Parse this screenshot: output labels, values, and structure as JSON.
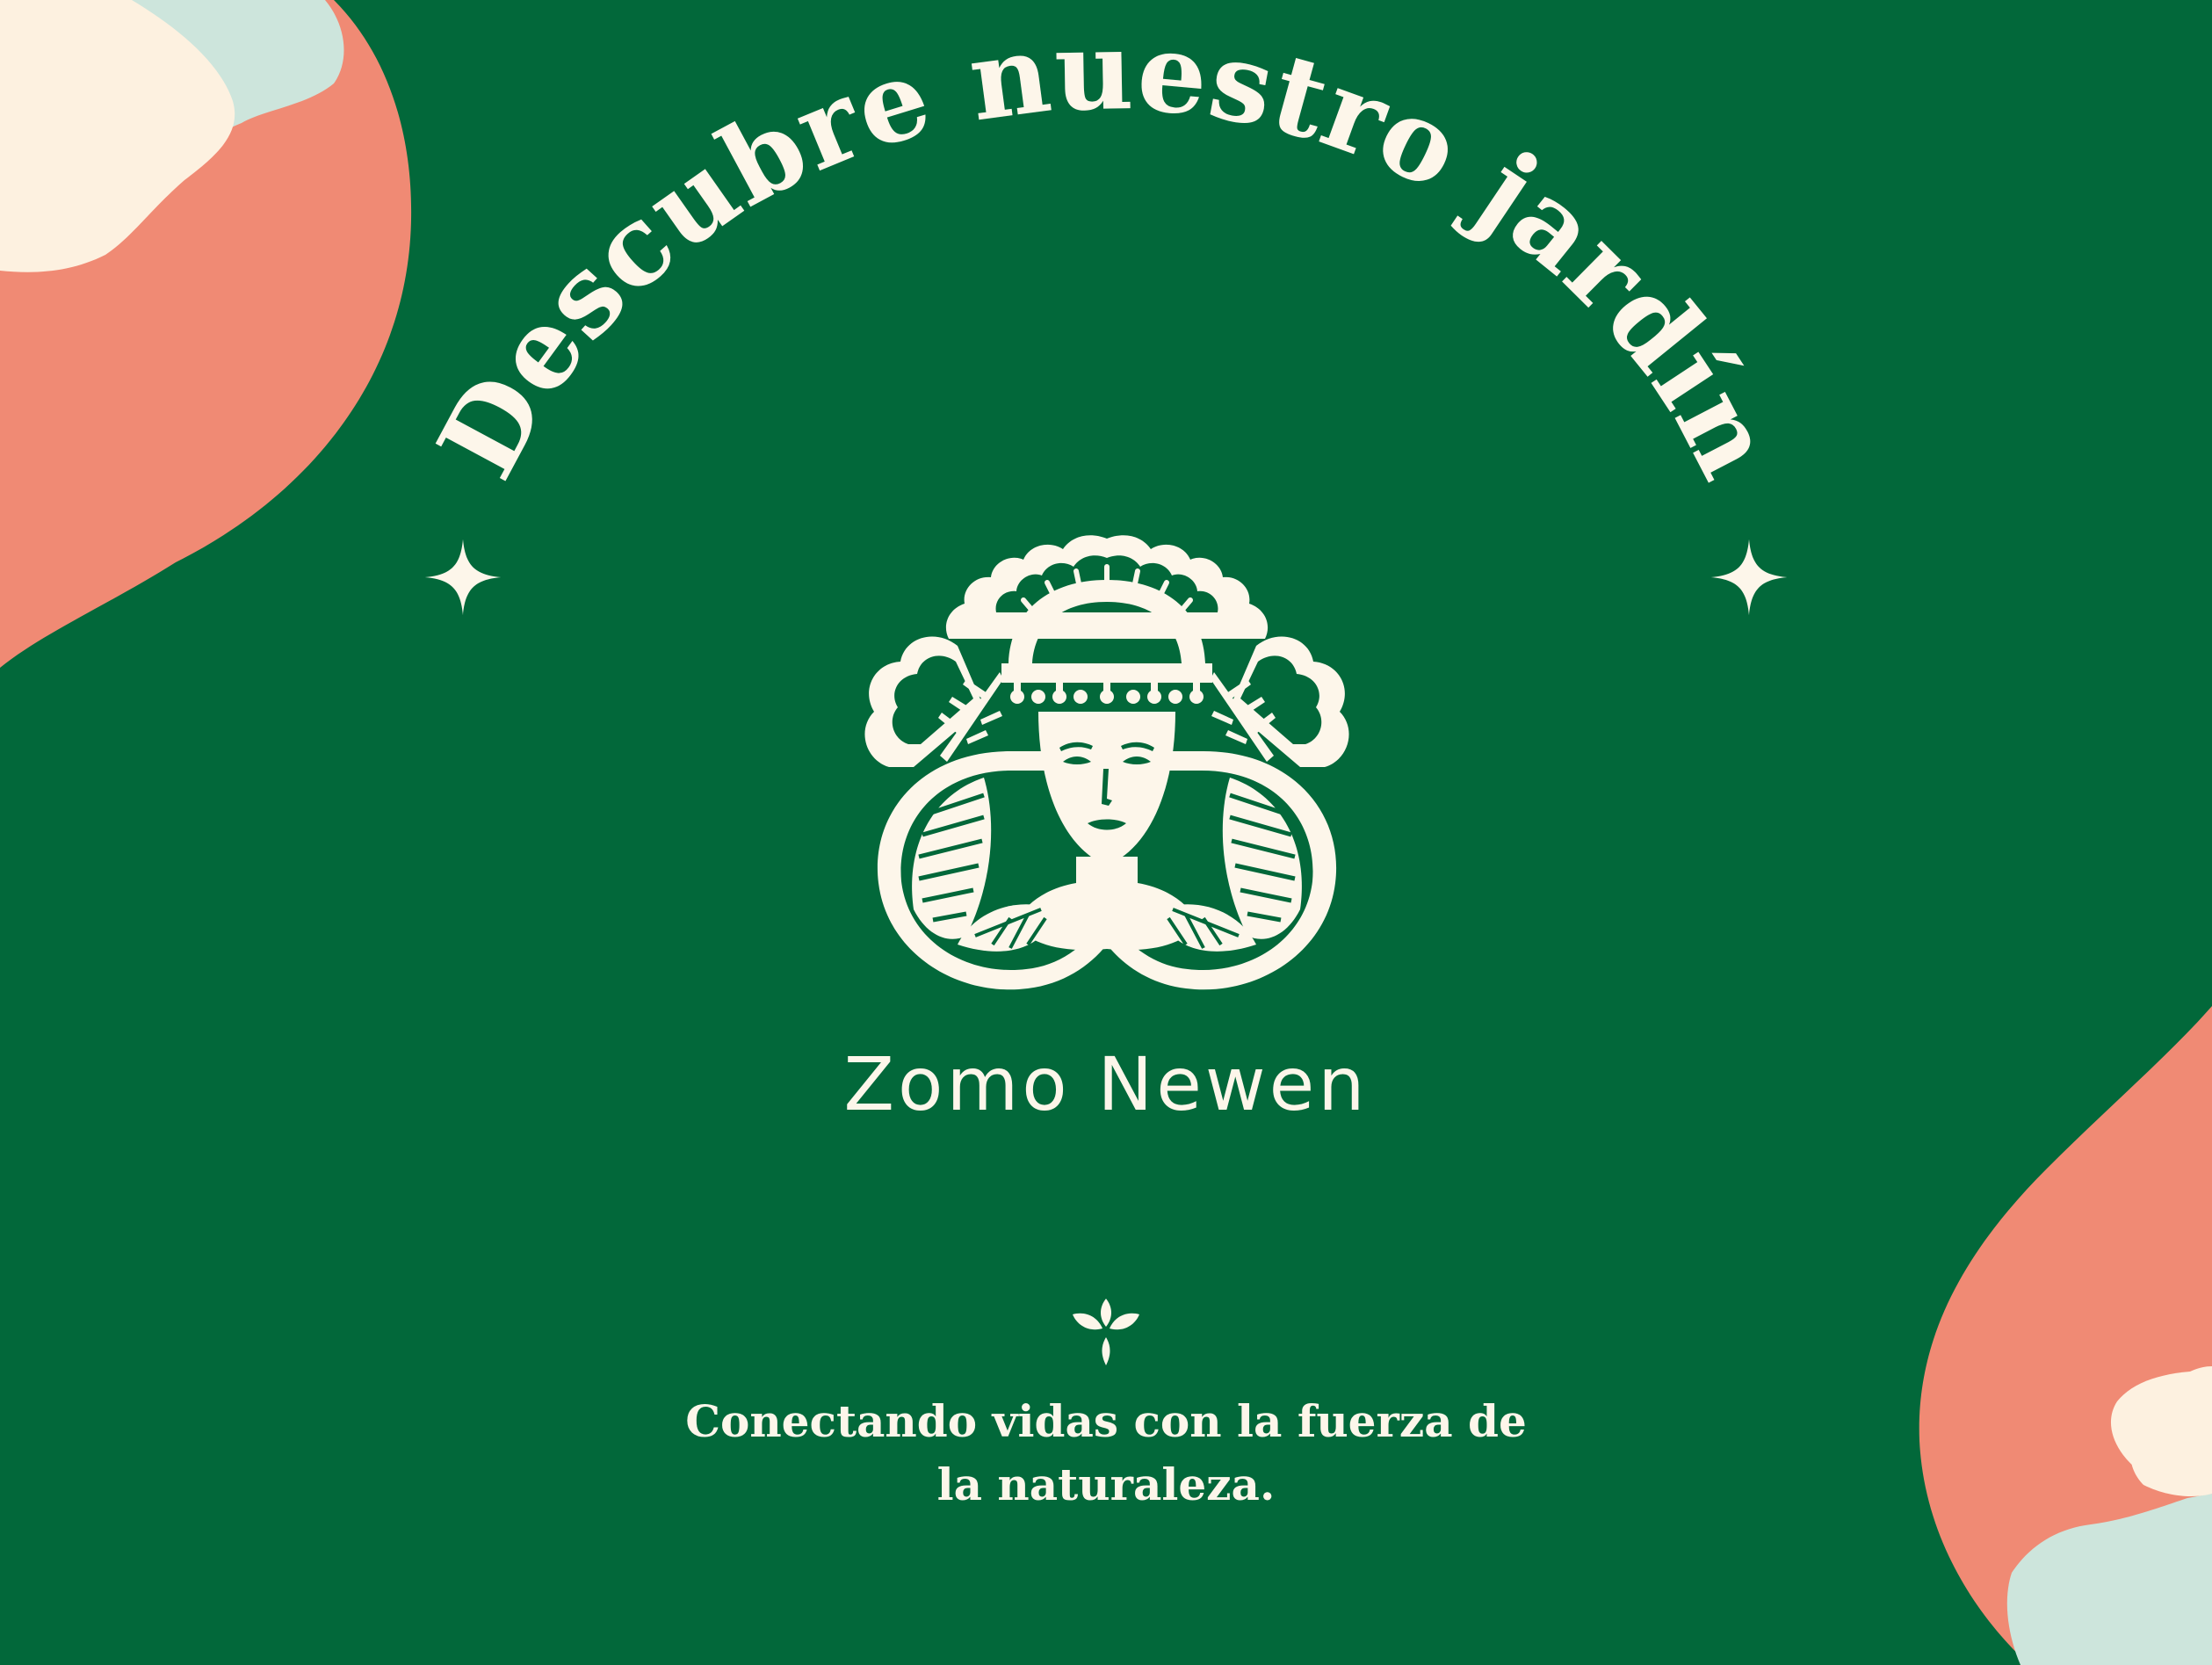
{
  "headline": {
    "text": "Descubre nuestro jardín"
  },
  "brand": {
    "name": "Zomo Newen"
  },
  "tagline": {
    "line1": "Conectando vidas con la fuerza de",
    "line2": "la naturaleza."
  },
  "colors": {
    "background": "#02683a",
    "cream": "#fdf6ea",
    "coral": "#f08a74",
    "mint": "#cde5dc"
  },
  "icons": {
    "left_sparkle": "sparkle-icon",
    "right_sparkle": "sparkle-icon",
    "logo": "woman-face-leaves-logo",
    "divider": "leaf-flourish-icon"
  }
}
